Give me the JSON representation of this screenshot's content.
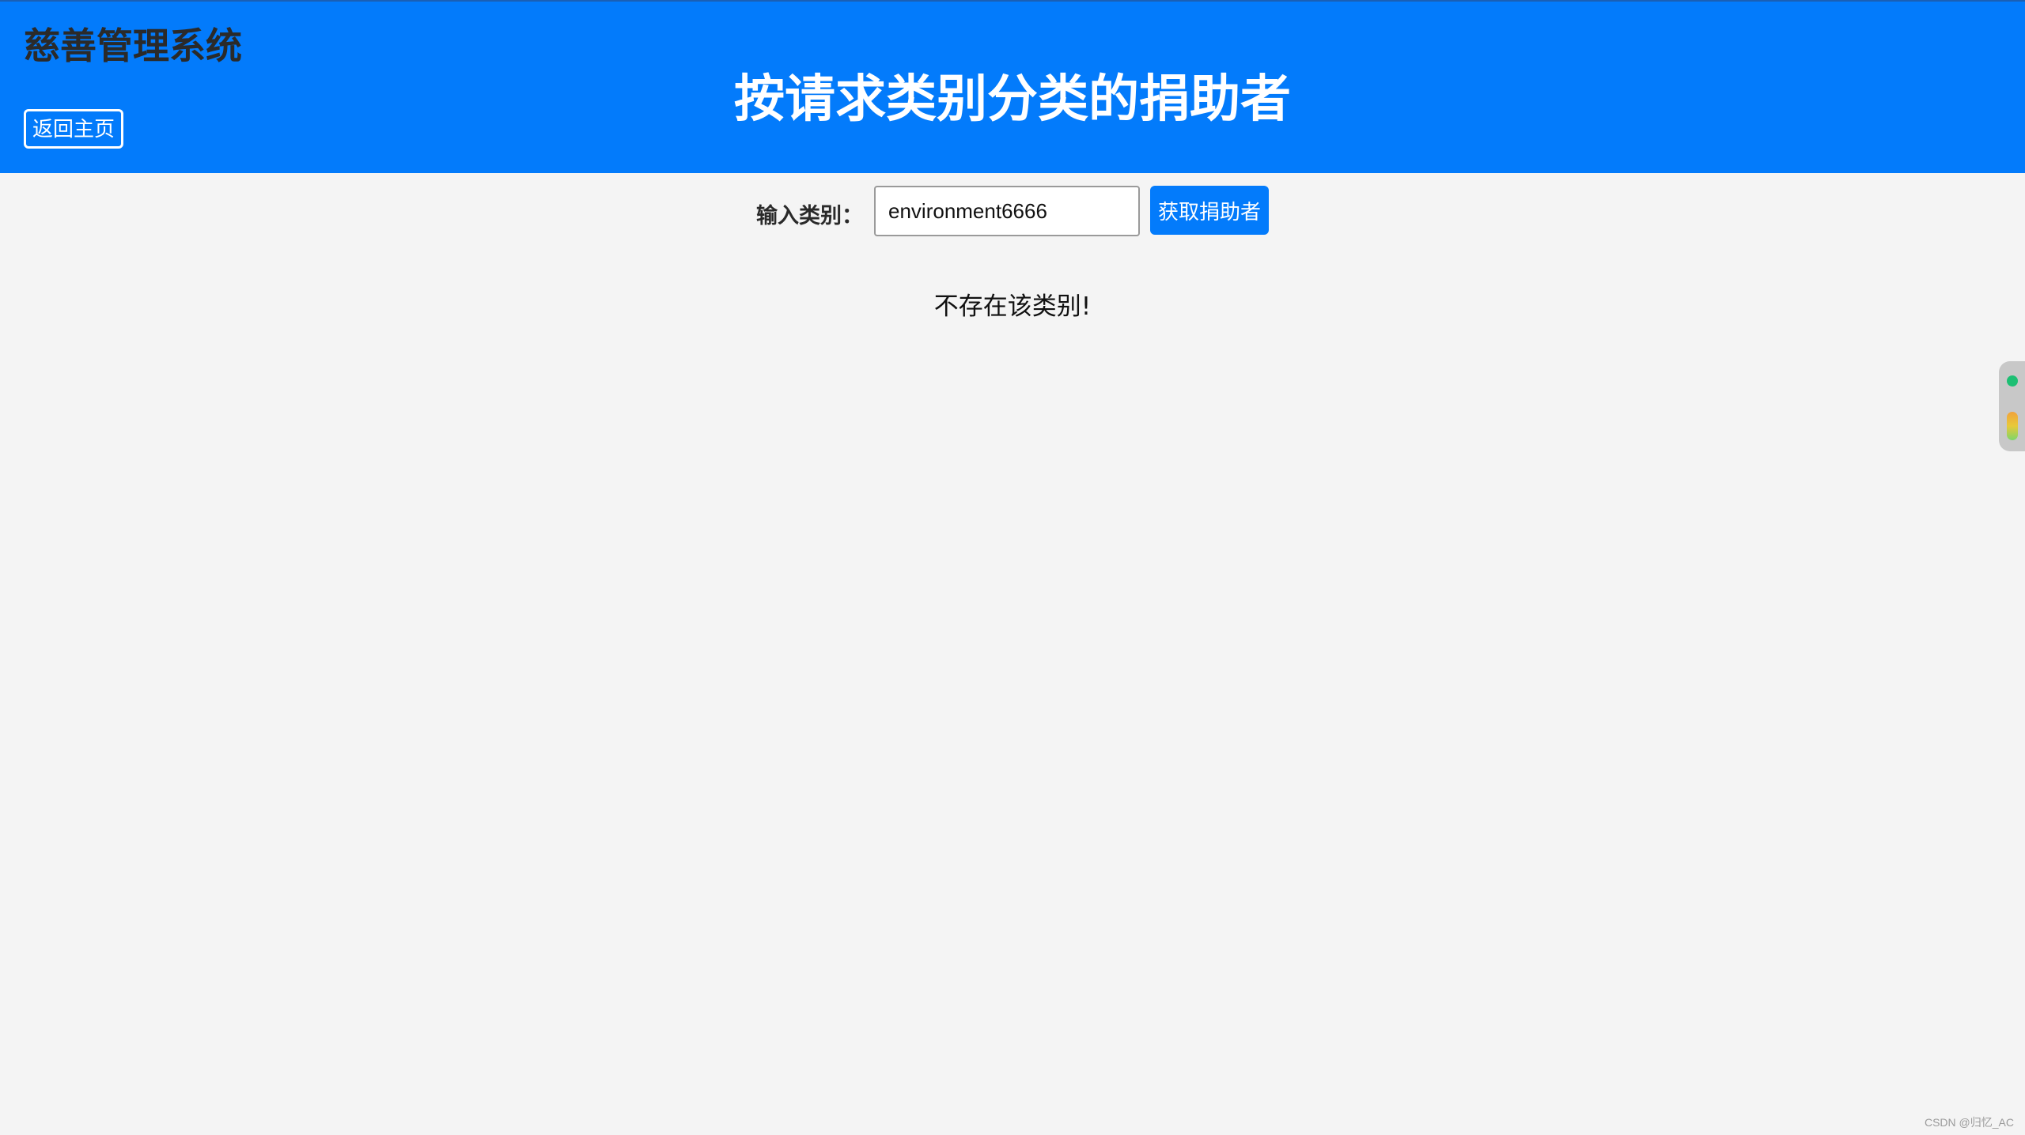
{
  "header": {
    "app_title": "慈善管理系统",
    "page_title": "按请求类别分类的捐助者",
    "home_button": "返回主页",
    "background_color": "#037bfb"
  },
  "search": {
    "label": "输入类别：",
    "input_value": "environment6666",
    "button_label": "获取捐助者"
  },
  "result": {
    "message": "不存在该类别!"
  },
  "side_widget": {
    "status_color": "#1dbf73"
  },
  "watermark": "CSDN @归忆_AC"
}
